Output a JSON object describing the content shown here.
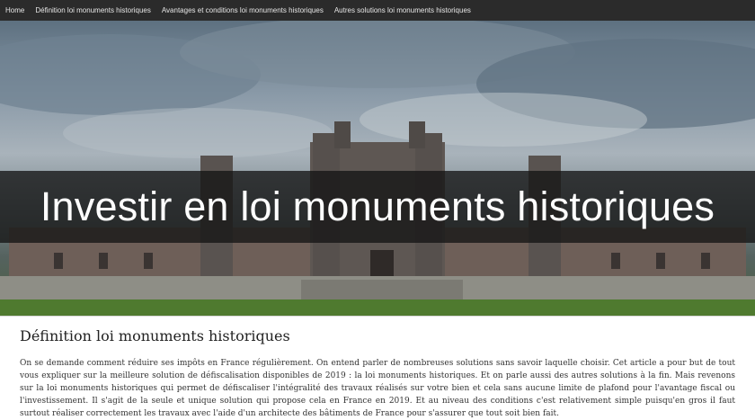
{
  "nav": {
    "items": [
      {
        "label": "Home"
      },
      {
        "label": "Définition loi monuments historiques"
      },
      {
        "label": "Avantages et conditions loi monuments historiques"
      },
      {
        "label": "Autres solutions loi monuments historiques"
      }
    ]
  },
  "hero": {
    "title": "Investir en loi monuments historiques"
  },
  "article": {
    "heading": "Définition loi monuments historiques",
    "body": "On se demande comment réduire ses impôts en France régulièrement. On entend parler de nombreuses solutions sans savoir laquelle choisir. Cet article a pour but de tout vous expliquer sur la meilleure solution de défiscalisation disponibles de 2019 : la loi monuments historiques. Et on parle aussi des autres solutions à la fin. Mais revenons sur la loi monuments historiques qui permet de défiscaliser l'intégralité des travaux réalisés sur votre bien et cela sans aucune limite de plafond pour l'avantage fiscal ou l'investissement. Il s'agit de la seule et unique solution qui propose cela en France en 2019. Et au niveau des conditions c'est relativement simple puisqu'en gros il faut surtout réaliser correctement les travaux avec l'aide d'un architecte des bâtiments de France pour s'assurer que tout soit bien fait."
  }
}
